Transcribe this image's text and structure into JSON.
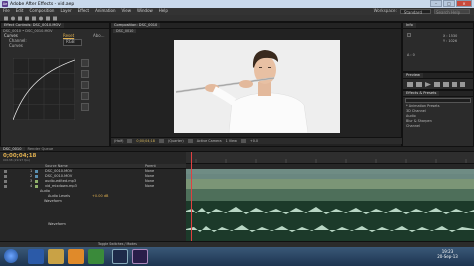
{
  "window": {
    "title": "Adobe After Effects - vid.aep",
    "minimize": "–",
    "maximize": "□",
    "close": "×"
  },
  "menu": [
    "File",
    "Edit",
    "Composition",
    "Layer",
    "Effect",
    "Animation",
    "View",
    "Window",
    "Help"
  ],
  "workspace": {
    "label": "Workspace:",
    "value": "Standard",
    "search_placeholder": "Search Help"
  },
  "effect_controls": {
    "tab": "Effect Controls: DSC_0010.MOV",
    "breadcrumb": "DSC_0010 • DSC_0010.MOV",
    "effect_name": "Curves",
    "reset": "Reset",
    "about": "Abo...",
    "channel_label": "Channel:",
    "channel_value": "RGB",
    "curves_label": "Curves"
  },
  "composition": {
    "tab": "Composition: DSC_0010",
    "subtab": "DSC_0010",
    "zoom": "(Half)",
    "timecode": "0;00;04;18",
    "resolution": "(Quarter)",
    "camera": "Active Camera",
    "views": "1 View",
    "exposure": "+0.0"
  },
  "info": {
    "tab": "Info",
    "x": "X : 1530",
    "y": "Y : 1026",
    "a": "A : 0"
  },
  "preview": {
    "tab": "Preview"
  },
  "effects_presets": {
    "tab": "Effects & Presets",
    "search_placeholder": "",
    "items": [
      "* Animation Presets",
      "3D Channel",
      "Audio",
      "Blur & Sharpen",
      "Channel"
    ]
  },
  "timeline": {
    "tab1": "DSC_0010",
    "tab2": "Render Queue",
    "timecode": "0;00;04;18",
    "sub": "00138 (29.97 fps)",
    "col_source": "Source Name",
    "col_parent": "Parent",
    "layers": [
      {
        "num": "1",
        "name": "DSC_0010.MOV",
        "parent": "None"
      },
      {
        "num": "2",
        "name": "DSC_0010.MOV",
        "parent": "None"
      },
      {
        "num": "3",
        "name": "audio-edited.mp3",
        "parent": "None"
      },
      {
        "num": "4",
        "name": "vid_mixdown.mp3",
        "parent": "None"
      }
    ],
    "audio_label": "Audio",
    "audio_levels_label": "Audio Levels",
    "audio_levels_value": "+0.00 dB",
    "waveform_label": "Waveform",
    "waveform_label2": "Waveform",
    "footer": "Toggle Switches / Modes"
  },
  "taskbar": {
    "clock_time": "19:23",
    "clock_date": "20-Sep-13"
  }
}
